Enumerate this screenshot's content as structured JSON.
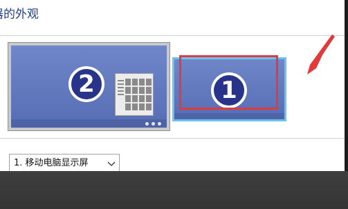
{
  "header": {
    "title": "器的外观"
  },
  "monitors": [
    {
      "number": "2",
      "state": "inactive"
    },
    {
      "number": "1",
      "state": "selected"
    }
  ],
  "display_select": {
    "value": "1. 移动电脑显示屏",
    "icon": "chevron-down-icon"
  },
  "colors": {
    "highlight": "#e23a3a",
    "arrow": "#e23a3a",
    "selection_border": "#68c3f0",
    "monitor_fill": "#5a72b9",
    "badge": "#28348a"
  }
}
